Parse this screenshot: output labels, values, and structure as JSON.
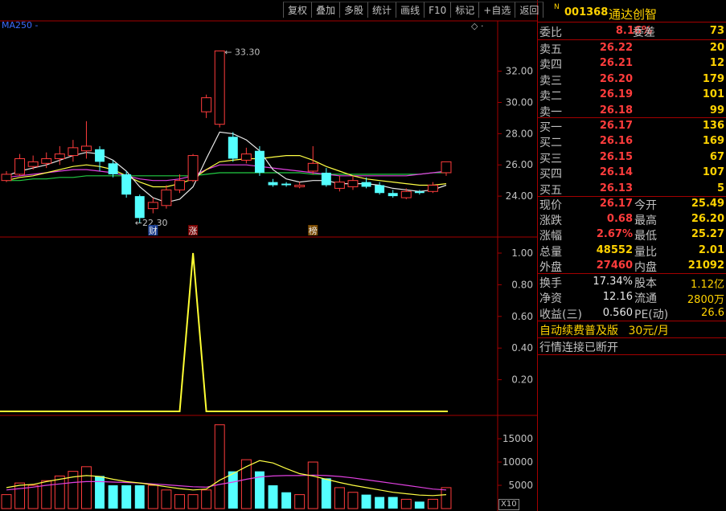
{
  "toolbar": [
    "复权",
    "叠加",
    "多股",
    "统计",
    "画线",
    "F10",
    "标记",
    "+自选",
    "返回"
  ],
  "indicator_label": "MA250 -",
  "stock": {
    "mark": "N",
    "code": "001368",
    "name": "通达创智"
  },
  "quote_depth": {
    "weibi": {
      "label": "委比",
      "value": "8.16%",
      "label2": "委差",
      "value2": "73"
    },
    "sell": [
      {
        "label": "卖五",
        "price": "26.22",
        "vol": "20"
      },
      {
        "label": "卖四",
        "price": "26.21",
        "vol": "12"
      },
      {
        "label": "卖三",
        "price": "26.20",
        "vol": "179"
      },
      {
        "label": "卖二",
        "price": "26.19",
        "vol": "101"
      },
      {
        "label": "卖一",
        "price": "26.18",
        "vol": "99"
      }
    ],
    "buy": [
      {
        "label": "买一",
        "price": "26.17",
        "vol": "136"
      },
      {
        "label": "买二",
        "price": "26.16",
        "vol": "169"
      },
      {
        "label": "买三",
        "price": "26.15",
        "vol": "67"
      },
      {
        "label": "买四",
        "price": "26.14",
        "vol": "107"
      },
      {
        "label": "买五",
        "price": "26.13",
        "vol": "5"
      }
    ]
  },
  "stats": [
    {
      "l1": "现价",
      "v1": "26.17",
      "c1": "red",
      "l2": "今开",
      "v2": "25.49",
      "c2": "wht"
    },
    {
      "l1": "涨跌",
      "v1": "0.68",
      "c1": "red",
      "l2": "最高",
      "v2": "26.20",
      "c2": "red"
    },
    {
      "l1": "涨幅",
      "v1": "2.67%",
      "c1": "red",
      "l2": "最低",
      "v2": "25.27",
      "c2": "grn"
    },
    {
      "l1": "总量",
      "v1": "48552",
      "c1": "yel",
      "l2": "量比",
      "v2": "2.01",
      "c2": "red"
    },
    {
      "l1": "外盘",
      "v1": "27460",
      "c1": "red",
      "l2": "内盘",
      "v2": "21092",
      "c2": "grn"
    }
  ],
  "stats2": [
    {
      "l1": "换手",
      "v1": "17.34%",
      "l2": "股本",
      "v2": "1.12亿"
    },
    {
      "l1": "净资",
      "v1": "12.16",
      "l2": "流通",
      "v2": "2800万"
    },
    {
      "l1": "收益(三)",
      "v1": "0.560",
      "l2": "PE(动)",
      "v2": "26.6"
    }
  ],
  "promo": {
    "text": "自动续费普及版",
    "price": "30元/月"
  },
  "status": "行情连接已断开",
  "x10_label": "X10",
  "chart_data": [
    {
      "type": "candlestick",
      "ylim": [
        22.0,
        34.5
      ],
      "yticks": [
        "32.00",
        "30.00",
        "28.00",
        "26.00",
        "24.00"
      ],
      "candles": [
        {
          "o": 25.0,
          "c": 25.4,
          "h": 25.6,
          "l": 24.9
        },
        {
          "o": 25.4,
          "c": 26.4,
          "h": 26.7,
          "l": 25.3
        },
        {
          "o": 25.9,
          "c": 26.2,
          "h": 26.6,
          "l": 25.7
        },
        {
          "o": 26.1,
          "c": 26.4,
          "h": 26.8,
          "l": 25.8
        },
        {
          "o": 26.4,
          "c": 26.7,
          "h": 27.2,
          "l": 26.0
        },
        {
          "o": 26.6,
          "c": 27.1,
          "h": 27.6,
          "l": 26.2
        },
        {
          "o": 26.9,
          "c": 27.2,
          "h": 28.8,
          "l": 26.4
        },
        {
          "o": 27.0,
          "c": 26.2,
          "h": 27.2,
          "l": 25.6
        },
        {
          "o": 26.1,
          "c": 25.4,
          "h": 26.3,
          "l": 25.2
        },
        {
          "o": 25.4,
          "c": 24.1,
          "h": 25.6,
          "l": 23.9
        },
        {
          "o": 24.0,
          "c": 22.6,
          "h": 24.1,
          "l": 22.3
        },
        {
          "o": 23.2,
          "c": 23.6,
          "h": 23.9,
          "l": 22.9
        },
        {
          "o": 23.4,
          "c": 24.4,
          "h": 24.7,
          "l": 23.2
        },
        {
          "o": 24.4,
          "c": 25.0,
          "h": 25.4,
          "l": 24.2
        },
        {
          "o": 25.0,
          "c": 26.6,
          "h": 26.7,
          "l": 24.9
        },
        {
          "o": 29.4,
          "c": 30.3,
          "h": 30.5,
          "l": 29.0
        },
        {
          "o": 28.6,
          "c": 33.3,
          "h": 33.3,
          "l": 28.4
        },
        {
          "o": 27.8,
          "c": 26.4,
          "h": 28.1,
          "l": 26.2
        },
        {
          "o": 26.3,
          "c": 26.7,
          "h": 27.1,
          "l": 26.1
        },
        {
          "o": 26.9,
          "c": 25.5,
          "h": 27.2,
          "l": 25.3
        },
        {
          "o": 24.9,
          "c": 24.7,
          "h": 25.1,
          "l": 24.6
        },
        {
          "o": 24.8,
          "c": 24.7,
          "h": 24.9,
          "l": 24.6
        },
        {
          "o": 24.6,
          "c": 24.7,
          "h": 24.9,
          "l": 24.5
        },
        {
          "o": 25.6,
          "c": 26.1,
          "h": 27.2,
          "l": 25.4
        },
        {
          "o": 25.5,
          "c": 24.7,
          "h": 25.8,
          "l": 24.6
        },
        {
          "o": 24.5,
          "c": 24.9,
          "h": 25.3,
          "l": 24.3
        },
        {
          "o": 24.6,
          "c": 25.0,
          "h": 25.3,
          "l": 24.4
        },
        {
          "o": 24.9,
          "c": 24.6,
          "h": 25.2,
          "l": 24.5
        },
        {
          "o": 24.7,
          "c": 24.2,
          "h": 24.9,
          "l": 24.1
        },
        {
          "o": 24.2,
          "c": 24.0,
          "h": 24.4,
          "l": 23.9
        },
        {
          "o": 23.9,
          "c": 24.3,
          "h": 24.5,
          "l": 23.8
        },
        {
          "o": 24.3,
          "c": 24.2,
          "h": 24.4,
          "l": 24.1
        },
        {
          "o": 24.3,
          "c": 24.7,
          "h": 24.9,
          "l": 24.2
        },
        {
          "o": 25.5,
          "c": 26.2,
          "h": 26.2,
          "l": 25.3
        }
      ],
      "ma_white": [
        25.3,
        25.6,
        25.8,
        26.0,
        26.3,
        26.6,
        26.8,
        26.7,
        26.3,
        25.6,
        24.6,
        23.9,
        23.6,
        23.8,
        24.6,
        26.4,
        28.1,
        28.0,
        27.6,
        26.9,
        25.7,
        25.1,
        24.9,
        25.0,
        25.0,
        24.8,
        24.8,
        24.8,
        24.7,
        24.5,
        24.4,
        24.3,
        24.4,
        24.7
      ],
      "ma_yellow": [
        25.0,
        25.2,
        25.3,
        25.5,
        25.7,
        25.9,
        26.0,
        25.9,
        25.7,
        25.3,
        24.9,
        24.6,
        24.6,
        24.8,
        25.1,
        25.7,
        26.2,
        26.3,
        26.4,
        26.4,
        26.5,
        26.6,
        26.6,
        26.3,
        25.9,
        25.6,
        25.3,
        25.1,
        25.0,
        24.9,
        24.8,
        24.7,
        24.7,
        24.8
      ],
      "ma_magenta": [
        25.2,
        25.3,
        25.4,
        25.5,
        25.6,
        25.7,
        25.7,
        25.6,
        25.5,
        25.3,
        25.1,
        25.0,
        25.0,
        25.1,
        25.3,
        25.7,
        26.0,
        26.0,
        26.0,
        25.9,
        25.8,
        25.7,
        25.6,
        25.5,
        25.4,
        25.3,
        25.3,
        25.3,
        25.3,
        25.3,
        25.3,
        25.4,
        25.5,
        25.6
      ],
      "ma_green": [
        25.0,
        25.0,
        25.1,
        25.1,
        25.2,
        25.2,
        25.3,
        25.3,
        25.3,
        25.3,
        25.3,
        25.3,
        25.3,
        25.3,
        25.3,
        25.4,
        25.5,
        25.5,
        25.5,
        25.5,
        25.5,
        25.5,
        25.5,
        25.4,
        25.4,
        25.4,
        25.4,
        25.4,
        25.4,
        25.4,
        25.4,
        25.4,
        25.5,
        25.5
      ],
      "annotations": [
        {
          "text": "33.30",
          "candle": 16,
          "price": 33.3
        },
        {
          "text": "22.30",
          "candle": 10,
          "price": 22.3
        }
      ],
      "event_markers": [
        {
          "text": "财",
          "candle": 11
        },
        {
          "text": "涨",
          "candle": 14
        },
        {
          "text": "榜",
          "candle": 23
        }
      ]
    },
    {
      "type": "line",
      "ylim": [
        0,
        1.1
      ],
      "yticks": [
        "1.00",
        "0.80",
        "0.60",
        "0.40",
        "0.20"
      ],
      "values": [
        0,
        0,
        0,
        0,
        0,
        0,
        0,
        0,
        0,
        0,
        0,
        0,
        0,
        0,
        1.0,
        0,
        0,
        0,
        0,
        0,
        0,
        0,
        0,
        0,
        0,
        0,
        0,
        0,
        0,
        0,
        0,
        0,
        0,
        0
      ],
      "color": "#ffff33"
    },
    {
      "type": "bar",
      "ylim": [
        0,
        19500
      ],
      "yticks": [
        "15000",
        "10000",
        "5000"
      ],
      "volumes": [
        3000,
        5500,
        5000,
        6000,
        7000,
        8000,
        9000,
        7000,
        5000,
        5000,
        5000,
        5000,
        4000,
        3000,
        3000,
        4000,
        18000,
        8000,
        10500,
        8000,
        5000,
        3500,
        3000,
        10000,
        6500,
        4500,
        3500,
        3000,
        2500,
        2500,
        2000,
        1500,
        2000,
        4500
      ],
      "up": [
        1,
        1,
        1,
        1,
        1,
        1,
        1,
        0,
        0,
        0,
        0,
        1,
        1,
        1,
        1,
        1,
        1,
        0,
        1,
        0,
        0,
        0,
        1,
        1,
        0,
        1,
        1,
        0,
        0,
        0,
        1,
        0,
        1,
        1
      ],
      "ma_yellow": [
        4500,
        5000,
        5200,
        5800,
        6300,
        6800,
        7100,
        6900,
        6300,
        5800,
        5500,
        5100,
        4700,
        4300,
        4000,
        4200,
        6100,
        7500,
        9000,
        10300,
        9800,
        8600,
        7500,
        7000,
        6300,
        5600,
        5000,
        4500,
        4000,
        3500,
        3200,
        2900,
        2800,
        3000
      ],
      "ma_magenta": [
        4000,
        4300,
        4600,
        5000,
        5300,
        5600,
        5800,
        5800,
        5700,
        5600,
        5500,
        5300,
        5100,
        4900,
        4700,
        4600,
        5200,
        5700,
        6300,
        6800,
        7000,
        7100,
        7100,
        7200,
        7100,
        6900,
        6600,
        6200,
        5800,
        5400,
        5000,
        4600,
        4200,
        4000
      ]
    }
  ]
}
